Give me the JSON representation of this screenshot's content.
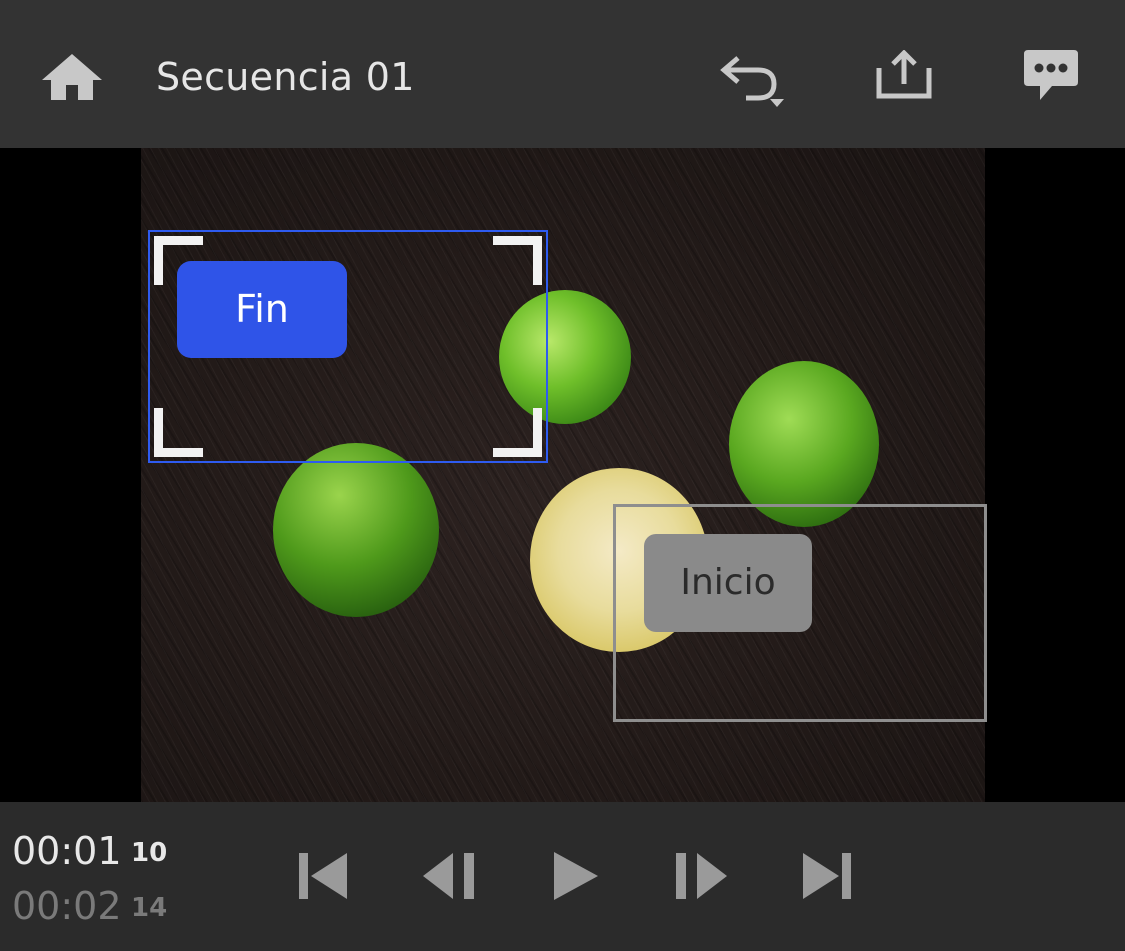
{
  "header": {
    "title": "Secuencia 01",
    "icons": [
      "home-icon",
      "undo-icon",
      "share-icon",
      "comments-icon"
    ]
  },
  "viewer": {
    "start_label": "Inicio",
    "end_label": "Fin",
    "end_box_color": "#2e5bf0",
    "start_box_color": "#8e8e8e"
  },
  "playback": {
    "current_time": "00:01",
    "current_frames": "10",
    "duration_time": "00:02",
    "duration_frames": "14",
    "controls": [
      "go-to-start-icon",
      "step-back-icon",
      "play-icon",
      "step-forward-icon",
      "go-to-end-icon"
    ]
  },
  "colors": {
    "accent": "#2f54e8",
    "topbar": "#333333",
    "bottombar": "#2b2b2b"
  }
}
